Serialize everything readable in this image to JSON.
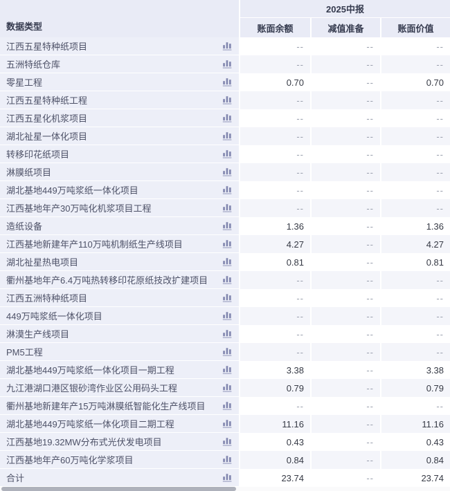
{
  "header": {
    "data_type_label": "数据类型",
    "period_label": "2025中报",
    "value_columns": [
      "账面余额",
      "减值准备",
      "账面价值"
    ]
  },
  "icons": {
    "row_icon": "bar-chart-icon"
  },
  "colors": {
    "header_bg": "#e9ebf6",
    "label_column_bg": "#edeff8",
    "stripe_row_bg": "#f4f5fa",
    "white_row_bg": "#ffffff",
    "icon_color": "#8388b0",
    "header_text": "#353a4e",
    "label_text": "#4d5167",
    "value_text": "#363a45",
    "empty_value_text": "#9aa0ae",
    "scrollbar_thumb": "#aeb1bb"
  },
  "rows": [
    {
      "label": "江西五星特种纸项目",
      "values": [
        "--",
        "--",
        "--"
      ]
    },
    {
      "label": "五洲特纸仓库",
      "values": [
        "--",
        "--",
        "--"
      ]
    },
    {
      "label": "零星工程",
      "values": [
        "0.70",
        "--",
        "0.70"
      ]
    },
    {
      "label": "江西五星特种纸工程",
      "values": [
        "--",
        "--",
        "--"
      ]
    },
    {
      "label": "江西五星化机浆项目",
      "values": [
        "--",
        "--",
        "--"
      ]
    },
    {
      "label": "湖北祉星一体化项目",
      "values": [
        "--",
        "--",
        "--"
      ]
    },
    {
      "label": "转移印花纸项目",
      "values": [
        "--",
        "--",
        "--"
      ]
    },
    {
      "label": "淋膜纸项目",
      "values": [
        "--",
        "--",
        "--"
      ]
    },
    {
      "label": "湖北基地449万吨浆纸一体化项目",
      "values": [
        "--",
        "--",
        "--"
      ]
    },
    {
      "label": "江西基地年产30万吨化机浆项目工程",
      "values": [
        "--",
        "--",
        "--"
      ]
    },
    {
      "label": "造纸设备",
      "values": [
        "1.36",
        "--",
        "1.36"
      ]
    },
    {
      "label": "江西基地新建年产110万吨机制纸生产线项目",
      "values": [
        "4.27",
        "--",
        "4.27"
      ]
    },
    {
      "label": "湖北祉星热电项目",
      "values": [
        "0.81",
        "--",
        "0.81"
      ]
    },
    {
      "label": "衢州基地年产6.4万吨热转移印花原纸技改扩建项目",
      "values": [
        "--",
        "--",
        "--"
      ]
    },
    {
      "label": "江西五洲特种纸项目",
      "values": [
        "--",
        "--",
        "--"
      ]
    },
    {
      "label": "449万吨浆纸一体化项目",
      "values": [
        "--",
        "--",
        "--"
      ]
    },
    {
      "label": "淋漠生产线项目",
      "values": [
        "--",
        "--",
        "--"
      ]
    },
    {
      "label": "PM5工程",
      "values": [
        "--",
        "--",
        "--"
      ]
    },
    {
      "label": "湖北基地449万吨浆纸一体化项目一期工程",
      "values": [
        "3.38",
        "--",
        "3.38"
      ]
    },
    {
      "label": "九江港湖口港区银砂湾作业区公用码头工程",
      "values": [
        "0.79",
        "--",
        "0.79"
      ]
    },
    {
      "label": "衢州基地新建年产15万吨淋膜纸智能化生产线项目",
      "values": [
        "--",
        "--",
        "--"
      ]
    },
    {
      "label": "湖北基地449万吨浆纸一体化项目二期工程",
      "values": [
        "11.16",
        "--",
        "11.16"
      ]
    },
    {
      "label": "江西基地19.32MW分布式光伏发电项目",
      "values": [
        "0.43",
        "--",
        "0.43"
      ]
    },
    {
      "label": "江西基地年产60万吨化学浆项目",
      "values": [
        "0.84",
        "--",
        "0.84"
      ]
    },
    {
      "label": "合计",
      "values": [
        "23.74",
        "--",
        "23.74"
      ]
    }
  ]
}
